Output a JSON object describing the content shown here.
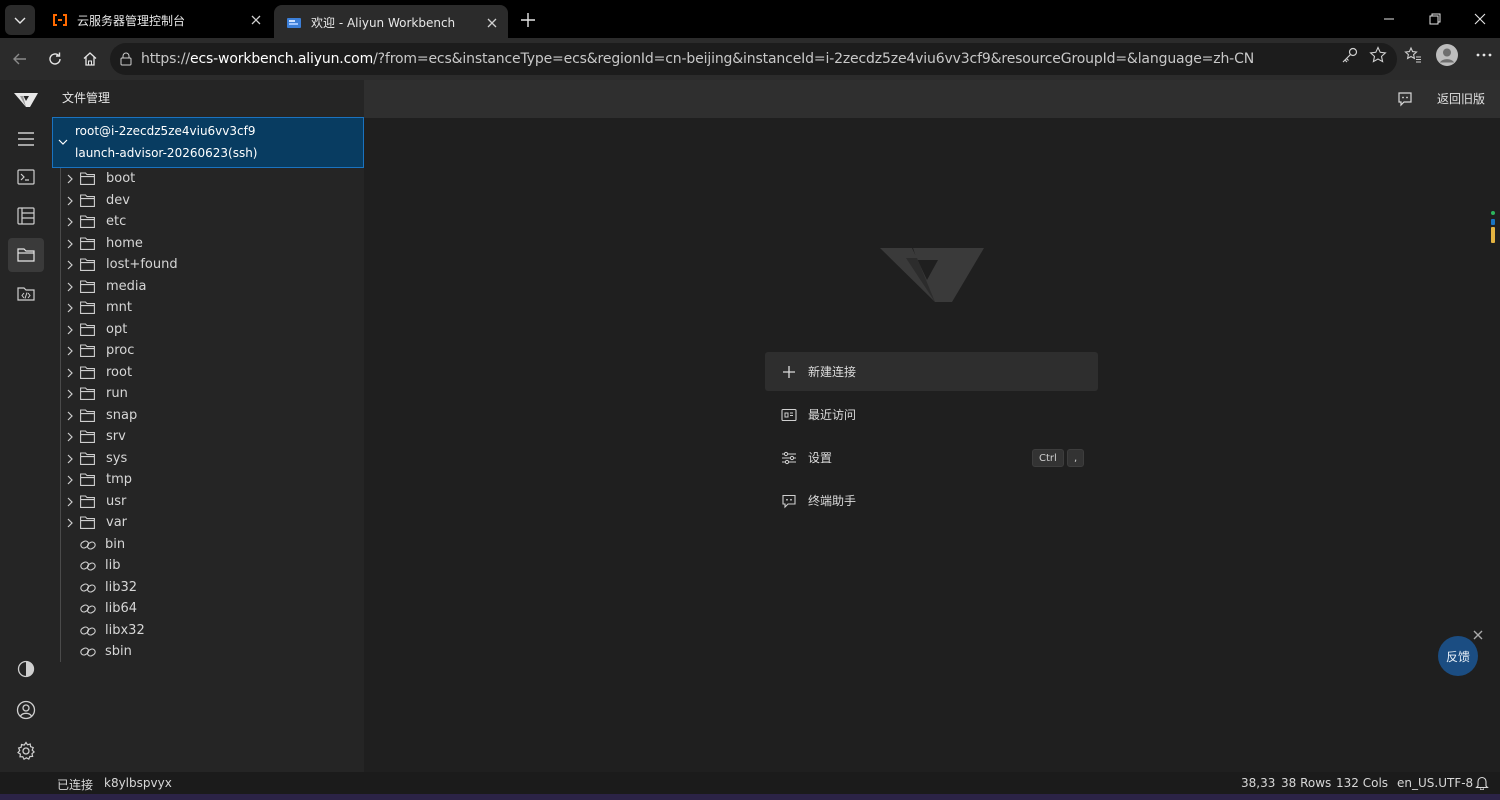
{
  "browser": {
    "tabs": [
      {
        "title": "云服务器管理控制台",
        "favicon": "aliyun-logo-icon",
        "active": false
      },
      {
        "title": "欢迎 - Aliyun Workbench",
        "favicon": "workbench-icon",
        "active": true
      }
    ],
    "url": {
      "prefix": "https://",
      "host": "ecs-workbench.aliyun.com",
      "path": "/?from=ecs&instanceType=ecs&regionId=cn-beijing&instanceId=i-2zecdz5ze4viu6vv3cf9&resourceGroupId=&language=zh-CN"
    }
  },
  "workbench": {
    "sidebar_title": "文件管理",
    "root": {
      "line1": "root@i-2zecdz5ze4viu6vv3cf9",
      "line2": "launch-advisor-20260623(ssh)"
    },
    "folders": [
      "boot",
      "dev",
      "etc",
      "home",
      "lost+found",
      "media",
      "mnt",
      "opt",
      "proc",
      "root",
      "run",
      "snap",
      "srv",
      "sys",
      "tmp",
      "usr",
      "var"
    ],
    "links": [
      "bin",
      "lib",
      "lib32",
      "lib64",
      "libx32",
      "sbin"
    ],
    "topbar": {
      "back_old": "返回旧版"
    },
    "welcome": {
      "new_connection": "新建连接",
      "recent": "最近访问",
      "settings": "设置",
      "settings_shortcut": [
        "Ctrl",
        ","
      ],
      "assistant": "终端助手"
    },
    "feedback": "反馈",
    "status": {
      "connected": "已连接",
      "session": "k8ylbspvyx",
      "cursor": "38,33",
      "rows": "38 Rows",
      "cols": "132 Cols",
      "encoding": "en_US.UTF-8"
    }
  },
  "colors": {
    "accent": "#1a73c0",
    "selected_bg": "#083c61",
    "feedback_bg": "#1b4d82",
    "aliyun_orange": "#ff6a00"
  }
}
